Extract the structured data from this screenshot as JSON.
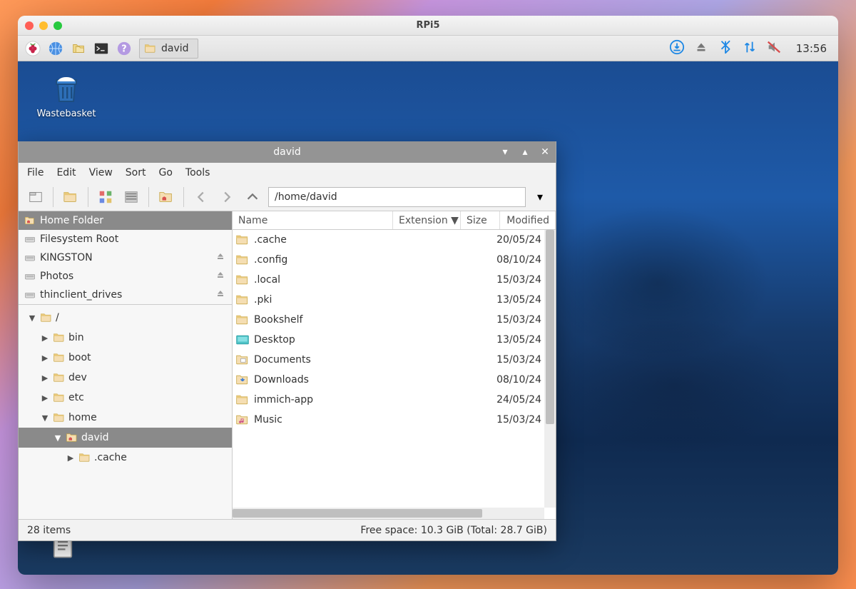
{
  "host": {
    "title": "RPi5"
  },
  "panel": {
    "task_label": "david",
    "clock": "13:56"
  },
  "desktop_icons": {
    "trash_label": "Wastebasket"
  },
  "fm": {
    "title": "david",
    "menu": [
      "File",
      "Edit",
      "View",
      "Sort",
      "Go",
      "Tools"
    ],
    "path": "/home/david",
    "places": [
      {
        "label": "Home Folder",
        "type": "home",
        "selected": true
      },
      {
        "label": "Filesystem Root",
        "type": "drive"
      },
      {
        "label": "KINGSTON",
        "type": "drive",
        "ejectable": true
      },
      {
        "label": "Photos",
        "type": "drive",
        "ejectable": true
      },
      {
        "label": "thinclient_drives",
        "type": "drive",
        "ejectable": true
      }
    ],
    "tree": [
      {
        "depth": 0,
        "label": "/",
        "expanded": true
      },
      {
        "depth": 1,
        "label": "bin"
      },
      {
        "depth": 1,
        "label": "boot"
      },
      {
        "depth": 1,
        "label": "dev"
      },
      {
        "depth": 1,
        "label": "etc"
      },
      {
        "depth": 1,
        "label": "home",
        "expanded": true
      },
      {
        "depth": 2,
        "label": "david",
        "expanded": true,
        "selected": true,
        "home": true
      },
      {
        "depth": 3,
        "label": ".cache"
      }
    ],
    "columns": {
      "name": "Name",
      "ext": "Extension",
      "size": "Size",
      "mod": "Modified"
    },
    "files": [
      {
        "name": ".cache",
        "modified": "20/05/24",
        "icon": "folder"
      },
      {
        "name": ".config",
        "modified": "08/10/24",
        "icon": "folder"
      },
      {
        "name": ".local",
        "modified": "15/03/24",
        "icon": "folder"
      },
      {
        "name": ".pki",
        "modified": "13/05/24",
        "icon": "folder"
      },
      {
        "name": "Bookshelf",
        "modified": "15/03/24",
        "icon": "folder"
      },
      {
        "name": "Desktop",
        "modified": "13/05/24",
        "icon": "desktop"
      },
      {
        "name": "Documents",
        "modified": "15/03/24",
        "icon": "documents"
      },
      {
        "name": "Downloads",
        "modified": "08/10/24",
        "icon": "downloads"
      },
      {
        "name": "immich-app",
        "modified": "24/05/24",
        "icon": "folder"
      },
      {
        "name": "Music",
        "modified": "15/03/24",
        "icon": "music"
      }
    ],
    "status": {
      "items": "28 items",
      "space": "Free space: 10.3 GiB (Total: 28.7 GiB)"
    }
  }
}
